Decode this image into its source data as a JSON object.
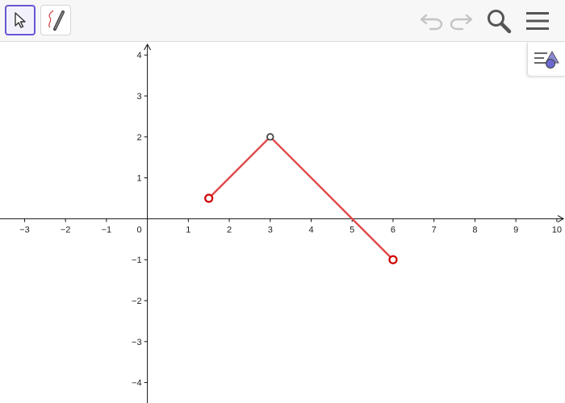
{
  "toolbar": {
    "tools": [
      {
        "name": "move-tool",
        "icon": "cursor-arrow-icon",
        "selected": true
      },
      {
        "name": "pen-tool",
        "icon": "pen-icon",
        "selected": false
      }
    ],
    "actions": [
      {
        "name": "undo-button",
        "icon": "undo-icon",
        "enabled": false
      },
      {
        "name": "redo-button",
        "icon": "redo-icon",
        "enabled": false
      },
      {
        "name": "search-button",
        "icon": "search-icon",
        "enabled": true
      },
      {
        "name": "menu-button",
        "icon": "hamburger-menu-icon",
        "enabled": true
      }
    ],
    "accent_color": "#6557d2"
  },
  "style_bar_toggle": {
    "icon": "style-bar-icon"
  },
  "graph": {
    "axes": {
      "x_min": -3.6,
      "x_max": 10.2,
      "y_min": -4.5,
      "y_max": 4.3,
      "x_ticks": [
        -3,
        -2,
        -1,
        1,
        2,
        3,
        4,
        5,
        6,
        7,
        8,
        9,
        10
      ],
      "y_ticks": [
        4,
        3,
        2,
        1,
        -1,
        -2,
        -3,
        -4
      ],
      "x_tick_labels": [
        "−3",
        "−2",
        "−1",
        "1",
        "2",
        "3",
        "4",
        "5",
        "6",
        "7",
        "8",
        "9",
        "10"
      ],
      "y_tick_labels": [
        "4",
        "3",
        "2",
        "1",
        "−1",
        "−2",
        "−3",
        "−4"
      ],
      "origin_label": "0",
      "grid": false
    },
    "polyline": {
      "color": "#e04848",
      "points": [
        {
          "x": 1.5,
          "y": 0.5,
          "style": "red-open"
        },
        {
          "x": 3,
          "y": 2,
          "style": "gray-open"
        },
        {
          "x": 6,
          "y": -1,
          "style": "red-open"
        }
      ]
    },
    "point_colors": {
      "red": "#d20000",
      "gray": "#444444"
    }
  }
}
